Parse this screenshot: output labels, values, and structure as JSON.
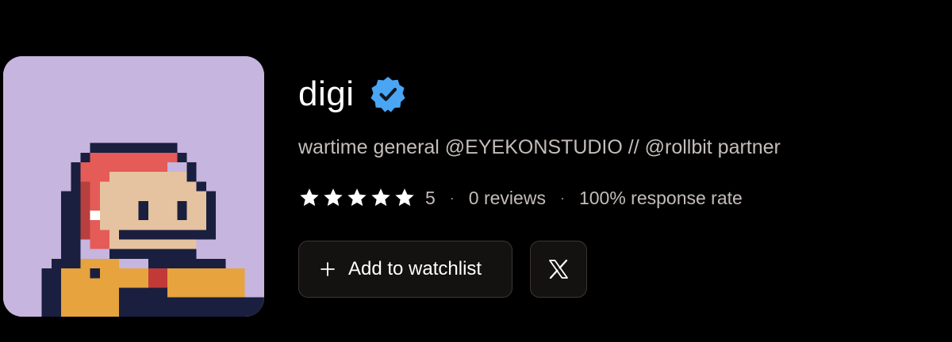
{
  "profile": {
    "name": "digi",
    "bio": "wartime general @EYEKONSTUDIO // @rollbit partner",
    "verified_icon": "verified-badge-icon",
    "avatar_bg": "#c6b5de"
  },
  "stats": {
    "star_count": 5,
    "rating": "5",
    "separator": "·",
    "reviews": "0 reviews",
    "response_rate": "100% response rate"
  },
  "actions": {
    "watchlist_icon": "plus-icon",
    "watchlist_label": "Add to watchlist",
    "x_icon": "x-logo-icon"
  },
  "colors": {
    "background": "#000000",
    "verified": "#4aa6f5",
    "text_secondary": "#c4bdba",
    "button_border": "#3c3634"
  }
}
